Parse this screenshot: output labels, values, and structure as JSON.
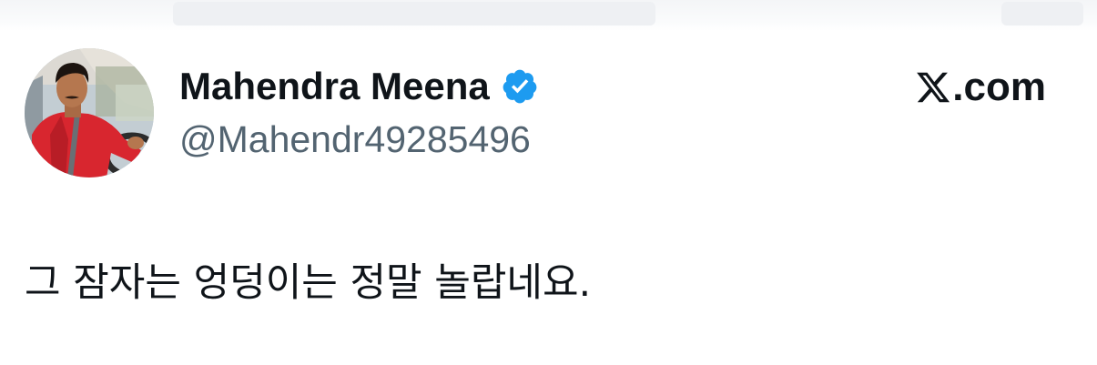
{
  "author": {
    "display_name": "Mahendra Meena",
    "handle": "@Mahendr49285496",
    "verified": true,
    "avatar_icon": "profile-photo-man-in-red-shirt-in-car"
  },
  "brand": {
    "logo_icon": "x-logo-icon",
    "label": ".com"
  },
  "tweet": {
    "text": "그 잠자는 엉덩이는 정말 놀랍네요."
  },
  "colors": {
    "verified_badge": "#1d9bf0",
    "text_primary": "#0f1419",
    "text_secondary": "#536471"
  }
}
